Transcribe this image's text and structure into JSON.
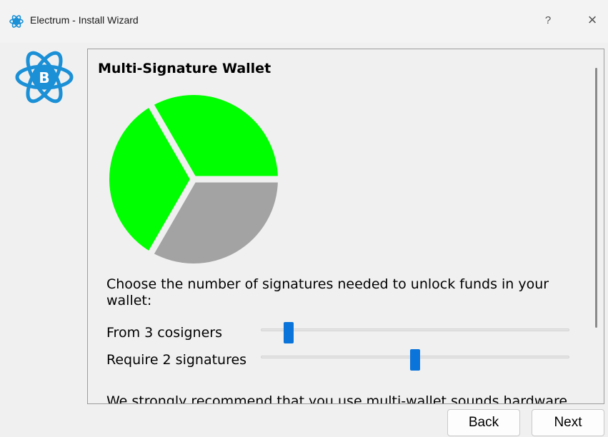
{
  "window": {
    "app_name": "Electrum",
    "separator": "-",
    "subtitle": "Install Wizard",
    "help_label": "?",
    "close_label": "×"
  },
  "wizard": {
    "heading": "Multi-Signature Wallet",
    "instructions": "Choose the number of signatures needed to unlock funds in your wallet:",
    "cosigners": {
      "label": "From 3 cosigners",
      "value": 3,
      "min": 2,
      "max": 15
    },
    "signatures": {
      "label": "Require 2 signatures",
      "value": 2,
      "min": 1,
      "max": 3
    },
    "cutoff_text": "We strongly recommend that you use multi-wallet sounds hardware"
  },
  "pie": {
    "total": 3,
    "required": 2,
    "colors": {
      "required": "#00ff00",
      "other": "#a3a3a3",
      "gap": "#f0f0f0"
    }
  },
  "buttons": {
    "back": "Back",
    "next": "Next"
  },
  "colors": {
    "accent": "#0a74da",
    "logo": "#1b90d6"
  },
  "icons": [
    "electrum-icon",
    "electrum-logo-icon"
  ]
}
